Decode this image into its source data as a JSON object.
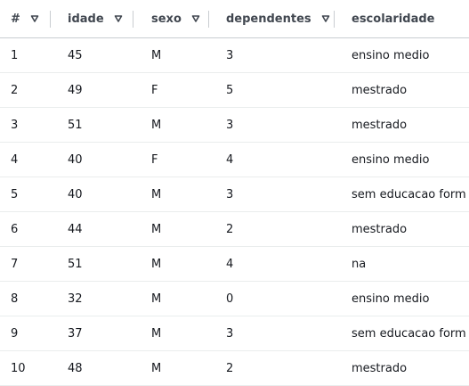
{
  "columns": [
    {
      "key": "idx",
      "label": "#"
    },
    {
      "key": "idade",
      "label": "idade"
    },
    {
      "key": "sexo",
      "label": "sexo"
    },
    {
      "key": "dependentes",
      "label": "dependentes"
    },
    {
      "key": "escolaridade",
      "label": "escolaridade"
    }
  ],
  "sort_icon": "sort-down-triangle-icon",
  "rows": [
    {
      "idx": "1",
      "idade": "45",
      "sexo": "M",
      "dependentes": "3",
      "escolaridade": "ensino medio"
    },
    {
      "idx": "2",
      "idade": "49",
      "sexo": "F",
      "dependentes": "5",
      "escolaridade": "mestrado"
    },
    {
      "idx": "3",
      "idade": "51",
      "sexo": "M",
      "dependentes": "3",
      "escolaridade": "mestrado"
    },
    {
      "idx": "4",
      "idade": "40",
      "sexo": "F",
      "dependentes": "4",
      "escolaridade": "ensino medio"
    },
    {
      "idx": "5",
      "idade": "40",
      "sexo": "M",
      "dependentes": "3",
      "escolaridade": "sem educacao form"
    },
    {
      "idx": "6",
      "idade": "44",
      "sexo": "M",
      "dependentes": "2",
      "escolaridade": "mestrado"
    },
    {
      "idx": "7",
      "idade": "51",
      "sexo": "M",
      "dependentes": "4",
      "escolaridade": "na"
    },
    {
      "idx": "8",
      "idade": "32",
      "sexo": "M",
      "dependentes": "0",
      "escolaridade": "ensino medio"
    },
    {
      "idx": "9",
      "idade": "37",
      "sexo": "M",
      "dependentes": "3",
      "escolaridade": "sem educacao form"
    },
    {
      "idx": "10",
      "idade": "48",
      "sexo": "M",
      "dependentes": "2",
      "escolaridade": "mestrado"
    }
  ]
}
